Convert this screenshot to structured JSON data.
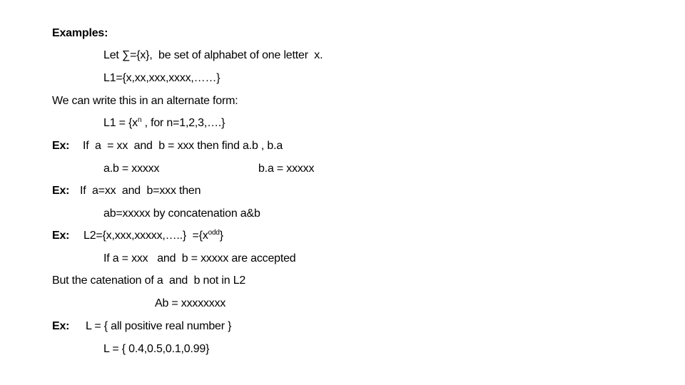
{
  "heading": "Examples:",
  "line1": "Let ∑={x},  be set of alphabet of one letter  x.",
  "line2": "L1={x,xx,xxx,xxxx,……}",
  "line3": "We can write this in an alternate form:",
  "line4": {
    "pre": "L1 = {x",
    "sup": "n",
    "post": " , for n=1,2,3,….}"
  },
  "ex_label": "Ex:",
  "ex1": {
    "label": "Ex:",
    "text": "If  a  = xx  and  b = xxx then find a.b , b.a"
  },
  "ex1_ab": "a.b = xxxxx",
  "ex1_ba": "b.a = xxxxx",
  "ex2": {
    "label": "Ex:",
    "text": "If  a=xx  and  b=xxx then"
  },
  "ex2_result": "ab=xxxxx by concatenation a&b",
  "ex3": {
    "label": "Ex:",
    "pre": "L2={x,xxx,xxxxx,…..}  ={x",
    "sup": "odd",
    "post": "}"
  },
  "ex3_line2": "If a = xxx   and  b = xxxxx are accepted",
  "ex3_line3": "But the catenation of a  and  b not in L2",
  "ex3_line4": "Ab = xxxxxxxx",
  "ex4": {
    "label": "Ex:",
    "text": "L = { all positive real number }"
  },
  "ex4_line2": "L = { 0.4,0.5,0.1,0.99}"
}
